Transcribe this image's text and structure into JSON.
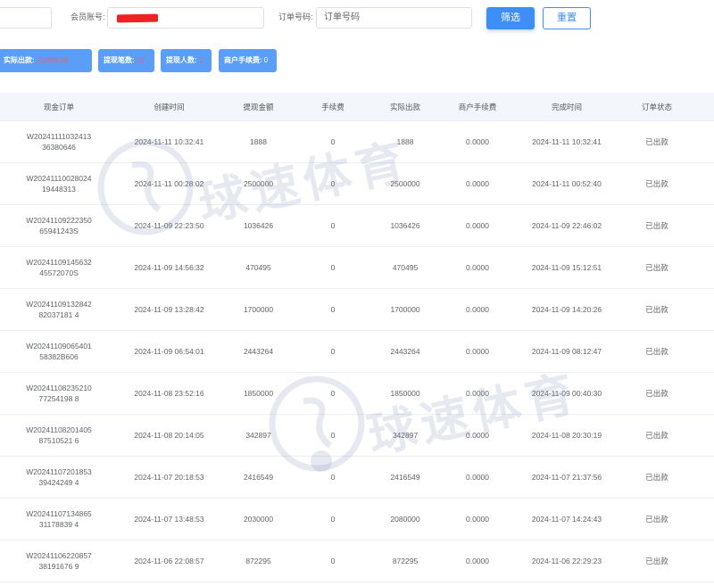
{
  "filters": {
    "member_label": "会员账号:",
    "order_label": "订单号码:",
    "order_placeholder": "订单号码",
    "filter_button": "筛选",
    "reset_button": "重置"
  },
  "stats": [
    {
      "label": "实际出款:",
      "value": "15299528"
    },
    {
      "label": "提现笔数:",
      "value": "12"
    },
    {
      "label": "提现人数:",
      "value": "1"
    },
    {
      "label": "商户手续费:",
      "value": "0"
    }
  ],
  "table": {
    "headers": [
      "现金订单",
      "创建时间",
      "提现金额",
      "手续费",
      "实际出款",
      "商户手续费",
      "完成时间",
      "订单状态"
    ],
    "rows": [
      {
        "order": "W2024111103241336380646",
        "created": "2024-11-11 10:32:41",
        "amount": "1888",
        "fee": "0",
        "actual": "1888",
        "mfee": "0.0000",
        "done": "2024-11-11 10:32:41",
        "status": "已出款"
      },
      {
        "order": "W2024111002802419448313",
        "created": "2024-11-11 00:28:02",
        "amount": "2500000",
        "fee": "0",
        "actual": "2500000",
        "mfee": "0.0000",
        "done": "2024-11-11 00:52:40",
        "status": "已出款"
      },
      {
        "order": "W2024110922235065941243S",
        "created": "2024-11-09 22:23:50",
        "amount": "1036426",
        "fee": "0",
        "actual": "1036426",
        "mfee": "0.0000",
        "done": "2024-11-09 22:46:02",
        "status": "已出款"
      },
      {
        "order": "W2024110914563245572070S",
        "created": "2024-11-09 14:56:32",
        "amount": "470495",
        "fee": "0",
        "actual": "470495",
        "mfee": "0.0000",
        "done": "2024-11-09 15:12:51",
        "status": "已出款"
      },
      {
        "order": "W2024110913284282037181 4",
        "created": "2024-11-09 13:28:42",
        "amount": "1700000",
        "fee": "0",
        "actual": "1700000",
        "mfee": "0.0000",
        "done": "2024-11-09 14:20:26",
        "status": "已出款"
      },
      {
        "order": "W2024110906540158382B606",
        "created": "2024-11-09 06:54:01",
        "amount": "2443264",
        "fee": "0",
        "actual": "2443264",
        "mfee": "0.0000",
        "done": "2024-11-09 08:12:47",
        "status": "已出款"
      },
      {
        "order": "W2024110823521077254198 8",
        "created": "2024-11-08 23:52:16",
        "amount": "1850000",
        "fee": "0",
        "actual": "1850000",
        "mfee": "0.0000",
        "done": "2024-11-09 00:40:30",
        "status": "已出款"
      },
      {
        "order": "W2024110820140587510521 6",
        "created": "2024-11-08 20:14:05",
        "amount": "342897",
        "fee": "0",
        "actual": "342897",
        "mfee": "0.0000",
        "done": "2024-11-08 20:30:19",
        "status": "已出款"
      },
      {
        "order": "W2024110720185339424249 4",
        "created": "2024-11-07 20:18:53",
        "amount": "2416549",
        "fee": "0",
        "actual": "2416549",
        "mfee": "0.0000",
        "done": "2024-11-07 21:37:56",
        "status": "已出款"
      },
      {
        "order": "W2024110713486531178839 4",
        "created": "2024-11-07 13:48:53",
        "amount": "2030000",
        "fee": "0",
        "actual": "2080000",
        "mfee": "0.0000",
        "done": "2024-11-07 14:24:43",
        "status": "已出款"
      },
      {
        "order": "W2024110622085738191676 9",
        "created": "2024-11-06 22:08:57",
        "amount": "872295",
        "fee": "0",
        "actual": "872295",
        "mfee": "0.0000",
        "done": "2024-11-06 22:29:23",
        "status": "已出款"
      }
    ]
  },
  "watermark": {
    "text": "球速体育"
  },
  "colors": {
    "primary": "#3e8ef7",
    "stat_bg": "#5a9ef7",
    "stat_value": "#ff5b5b",
    "header_bg": "#f3f6fb"
  }
}
